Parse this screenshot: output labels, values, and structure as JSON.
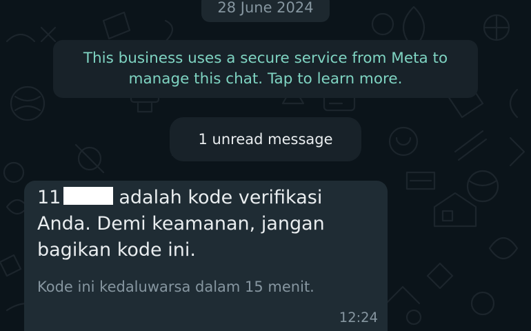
{
  "chat": {
    "date_chip": "28 June 2024",
    "meta_notice": {
      "line1": "This business uses a secure service from Meta to",
      "line2": "manage this chat. Tap to learn more."
    },
    "unread_chip": "1 unread message",
    "message": {
      "code_prefix": "11",
      "line1_rest": "adalah kode verifikasi",
      "line2": "Anda. Demi keamanan, jangan",
      "line3": "bagikan kode ini.",
      "footer": "Kode ini kedaluwarsa dalam 15 menit.",
      "time": "12:24"
    }
  },
  "colors": {
    "background": "#0b141a",
    "bubble": "#1f2c34",
    "notice_text": "#7fd4c2",
    "secondary_text": "#8696a0",
    "primary_text": "#e9edef",
    "redaction": "#ffffff"
  }
}
